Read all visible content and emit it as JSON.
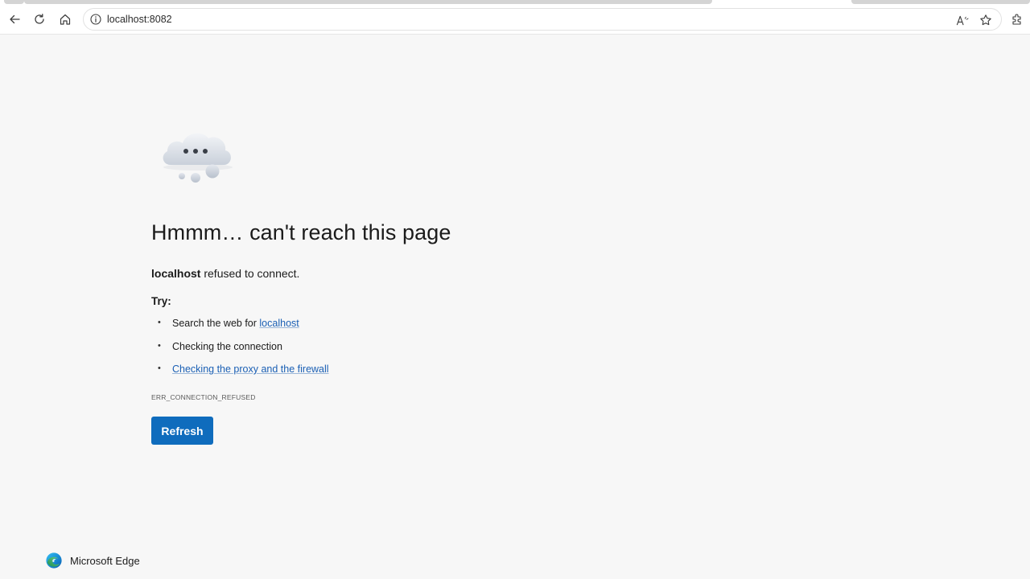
{
  "browser": {
    "url": "localhost:8082"
  },
  "error_page": {
    "headline": "Hmmm… can't reach this page",
    "host": "localhost",
    "refused_text": " refused to connect.",
    "try_label": "Try:",
    "suggestions": {
      "search_prefix": "Search the web for ",
      "search_link": "localhost",
      "checking_connection": "Checking the connection",
      "checking_proxy": "Checking the proxy and the firewall"
    },
    "error_code": "ERR_CONNECTION_REFUSED",
    "refresh_label": "Refresh"
  },
  "footer": {
    "brand": "Microsoft Edge"
  },
  "icons": {
    "back": "back-arrow-icon",
    "reload": "reload-icon",
    "home": "home-icon",
    "info": "info-icon",
    "read_aloud": "read-aloud-icon",
    "favorite": "star-icon",
    "extensions": "extensions-icon"
  },
  "colors": {
    "accent": "#0f6cbd",
    "link": "#1a5fb4",
    "page_background": "#f7f7f7"
  }
}
